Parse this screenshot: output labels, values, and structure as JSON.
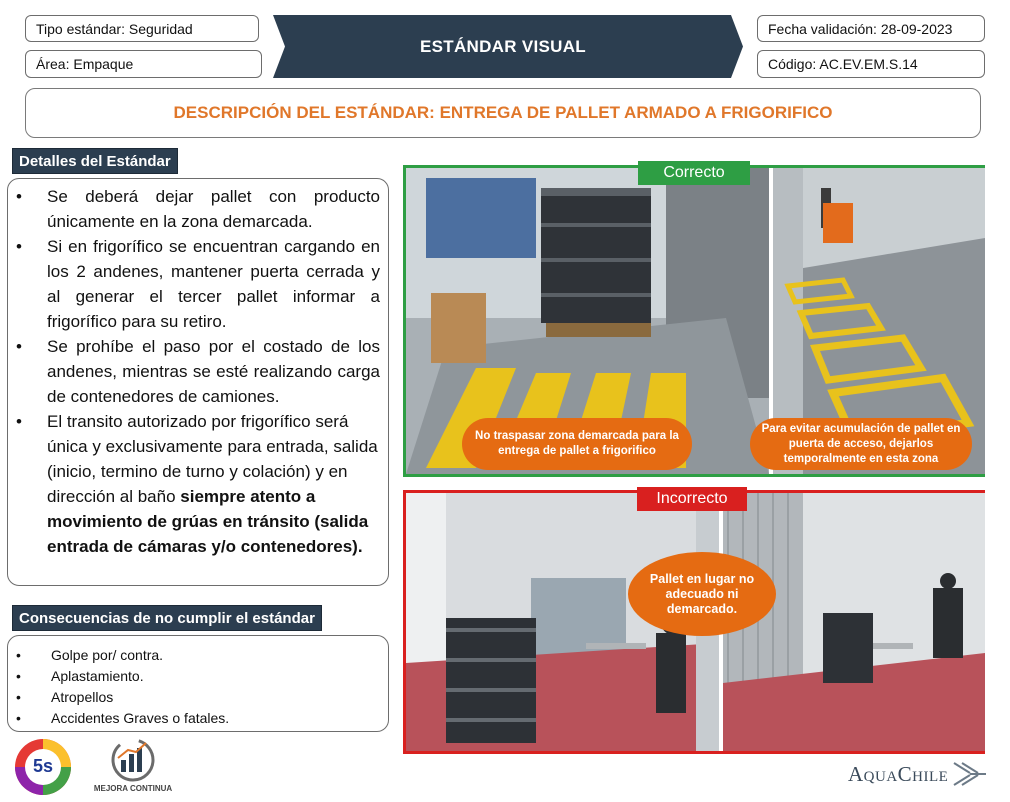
{
  "header": {
    "tipo_estandar": "Tipo estándar: Seguridad",
    "area": "Área: Empaque",
    "banner_title": "ESTÁNDAR VISUAL",
    "fecha_validacion": "Fecha validación: 28-09-2023",
    "codigo": "Código:  AC.EV.EM.S.14"
  },
  "title": "DESCRIPCIÓN DEL ESTÁNDAR: ENTREGA DE PALLET ARMADO A FRIGORIFICO",
  "details": {
    "heading": "Detalles del Estándar",
    "items": [
      {
        "text": "Se deberá dejar pallet con producto únicamente en la zona demarcada.",
        "bold": ""
      },
      {
        "text": "Si en frigorífico se encuentran cargando en los 2 andenes, mantener puerta cerrada y al generar el tercer pallet informar a frigorífico para su retiro.",
        "bold": ""
      },
      {
        "text": "Se prohíbe el paso por el costado de los andenes, mientras se esté realizando carga de contenedores de camiones.",
        "bold": ""
      },
      {
        "text": "El transito autorizado por frigorífico será única y exclusivamente para entrada, salida (inicio, termino de turno y colación) y en dirección al baño ",
        "bold": "siempre atento a movimiento de grúas en tránsito (salida entrada de cámaras y/o contenedores)."
      }
    ]
  },
  "consequences": {
    "heading": "Consecuencias de no cumplir el estándar",
    "items": [
      "Golpe por/ contra.",
      "Aplastamiento.",
      "Atropellos",
      "Accidentes Graves o fatales."
    ]
  },
  "correct": {
    "label": "Correcto",
    "color": "#2e9e44",
    "callout_left": "No traspasar zona demarcada para la entrega de pallet  a frigorifico",
    "callout_right": "Para evitar acumulación  de pallet en puerta de acceso,  dejarlos temporalmente en esta zona"
  },
  "incorrect": {
    "label": "Incorrecto",
    "color": "#d9201f",
    "callout": "Pallet en lugar no adecuado ni demarcado."
  },
  "logos": {
    "five_s": "5s",
    "mejora": "MEJORA CONTINUA",
    "company": "AquaChile"
  },
  "colors": {
    "banner": "#2c3e50",
    "accent_orange": "#e0772a",
    "callout": "#e56b12"
  }
}
